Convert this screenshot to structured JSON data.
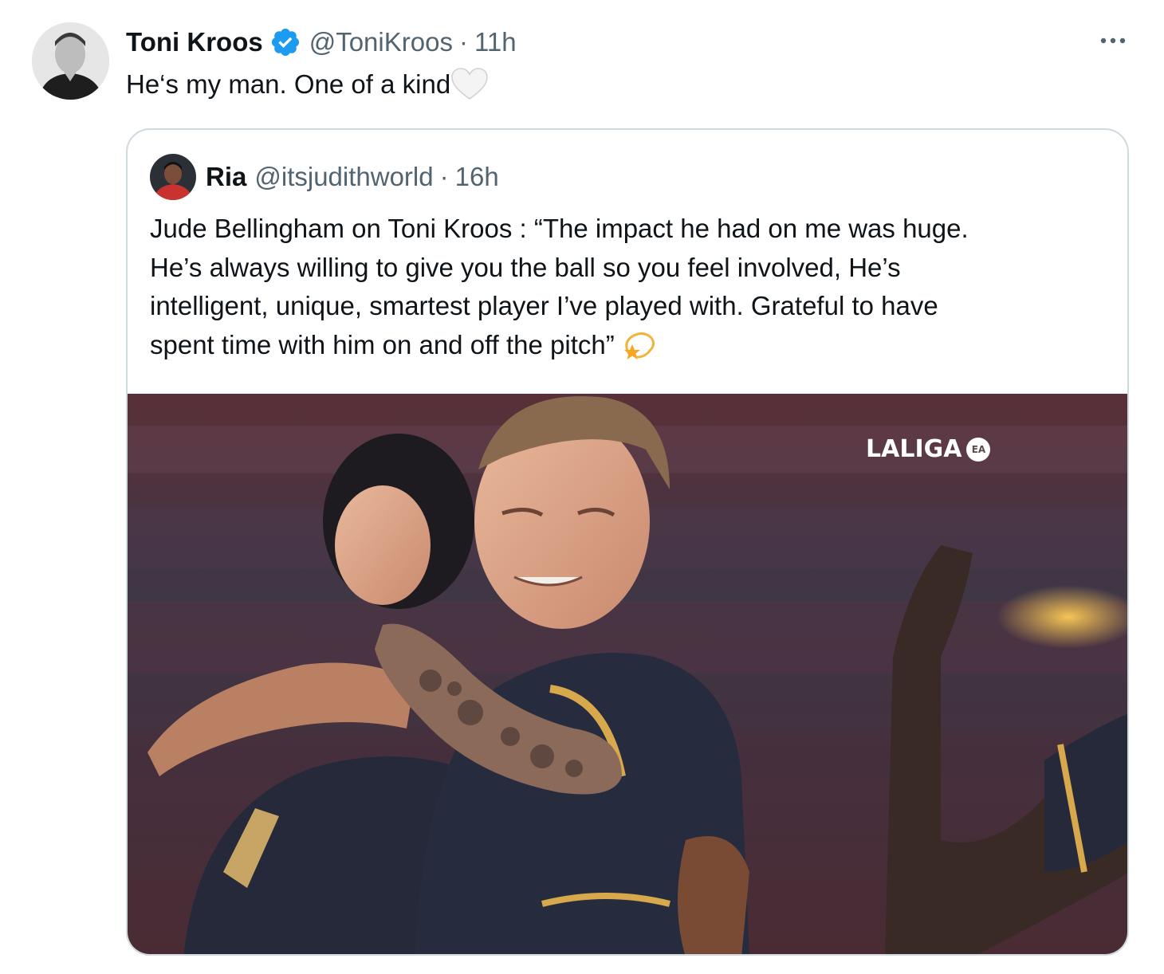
{
  "tweet": {
    "author_name": "Toni Kroos",
    "handle": "@ToniKroos",
    "separator": "·",
    "time": "11h",
    "text": "He‘s my man. One of a kind",
    "colors": {
      "text": "#0f1419",
      "secondary": "#536471",
      "verified": "#1d9bf0",
      "border": "#cfd9de"
    },
    "icons": [
      "verified-badge-icon",
      "more-icon",
      "white-heart-emoji"
    ]
  },
  "quote": {
    "author_name": "Ria",
    "handle": "@itsjudithworld",
    "separator": "·",
    "time": "16h",
    "text_lines": [
      "Jude Bellingham on Toni Kroos : “The impact he had on me was huge.",
      "He’s always willing to give you the ball so you feel involved, He’s",
      "intelligent, unique, smartest player I’ve played with. Grateful to have",
      "spent time with him on and off the pitch”"
    ],
    "emoji": "dizzy-star-emoji",
    "media": {
      "watermark": "LALIGA",
      "watermark_badge": "EA"
    }
  }
}
